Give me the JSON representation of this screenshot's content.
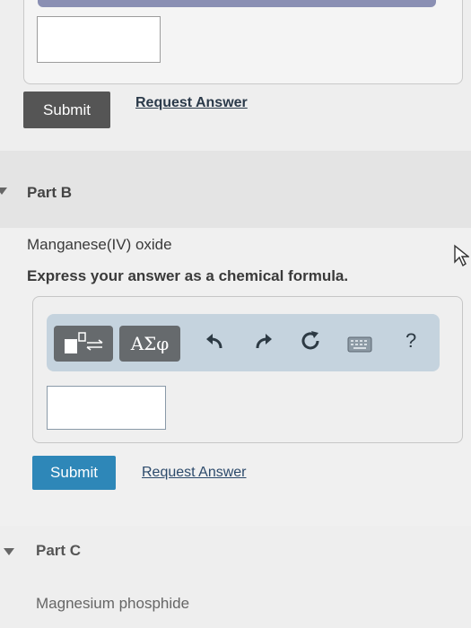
{
  "partA": {
    "submit_label": "Submit",
    "request_answer_label": "Request Answer"
  },
  "partB": {
    "title": "Part B",
    "question": "Manganese(IV) oxide",
    "instruction": "Express your answer as a chemical formula.",
    "toolbar": {
      "greek_label": "ΑΣφ",
      "help_label": "?"
    },
    "submit_label": "Submit",
    "request_answer_label": "Request Answer"
  },
  "partC": {
    "title": "Part C",
    "question": "Magnesium phosphide"
  },
  "colors": {
    "submit_dark": "#555555",
    "submit_blue": "#2e87b8",
    "link": "#2c4a6b",
    "toolbar_bg": "#c5d3de"
  }
}
